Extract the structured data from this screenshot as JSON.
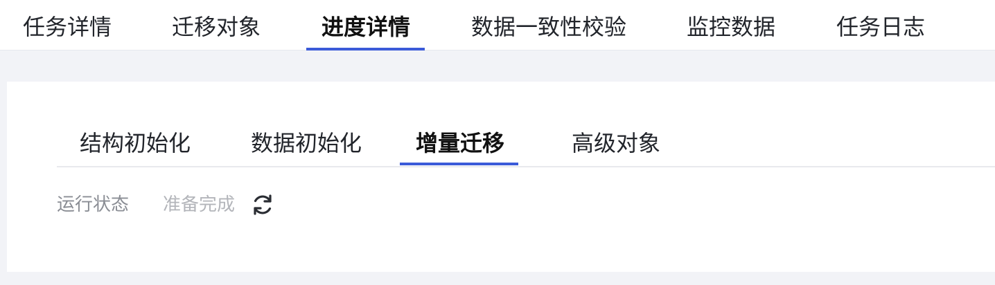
{
  "top_tabs": [
    {
      "label": "任务详情",
      "active": false
    },
    {
      "label": "迁移对象",
      "active": false
    },
    {
      "label": "进度详情",
      "active": true
    },
    {
      "label": "数据一致性校验",
      "active": false
    },
    {
      "label": "监控数据",
      "active": false
    },
    {
      "label": "任务日志",
      "active": false
    }
  ],
  "sub_tabs": [
    {
      "label": "结构初始化",
      "active": false
    },
    {
      "label": "数据初始化",
      "active": false
    },
    {
      "label": "增量迁移",
      "active": true
    },
    {
      "label": "高级对象",
      "active": false
    }
  ],
  "status": {
    "label": "运行状态",
    "value": "准备完成",
    "refresh_icon": "refresh-icon"
  },
  "colors": {
    "accent": "#3b5bd9",
    "page_background": "#f2f3f7"
  }
}
